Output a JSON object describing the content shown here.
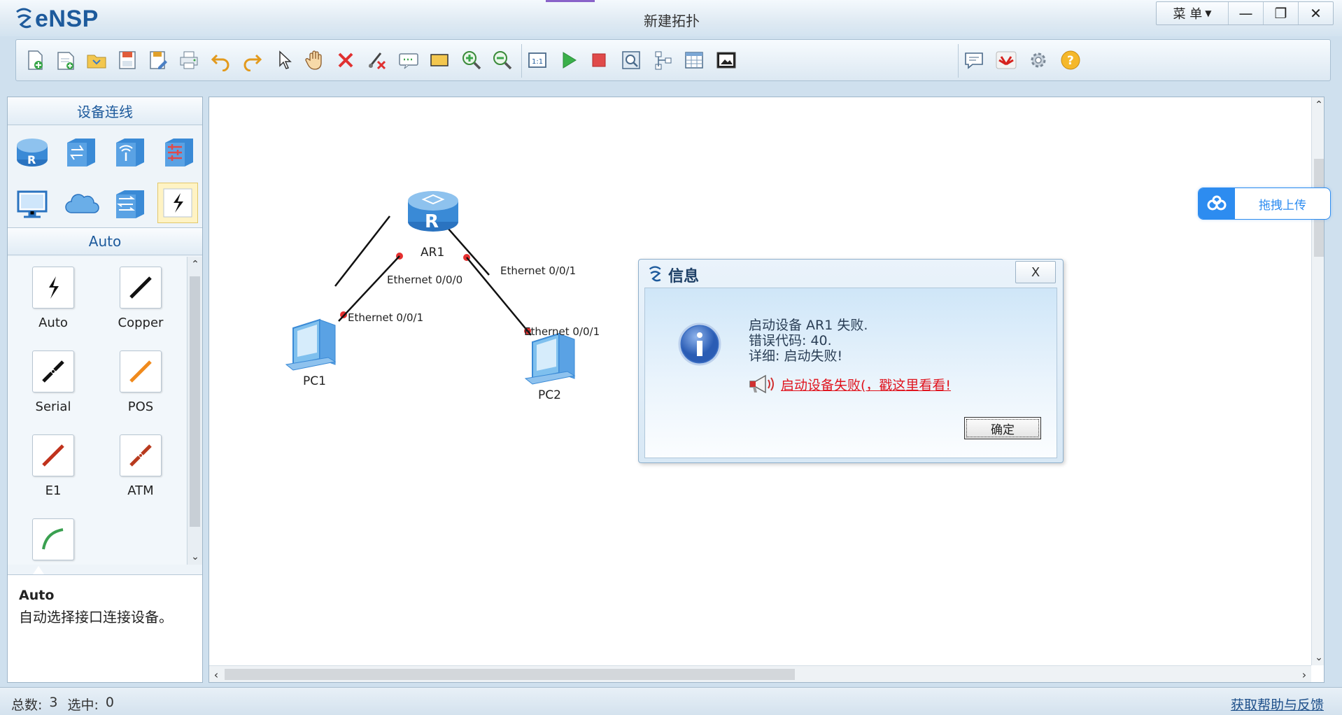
{
  "app": {
    "name": "eNSP",
    "window_title": "新建拓扑"
  },
  "window_controls": {
    "menu_label": "菜 单",
    "minimize": "—",
    "restore": "❐",
    "close": "✕"
  },
  "left_panel": {
    "section_title": "设备连线",
    "sub_title": "Auto",
    "devices": [
      {
        "icon": "router-icon"
      },
      {
        "icon": "switch-icon"
      },
      {
        "icon": "wireless-icon"
      },
      {
        "icon": "firewall-icon"
      },
      {
        "icon": "pc-icon"
      },
      {
        "icon": "cloud-icon"
      },
      {
        "icon": "other-device-icon"
      },
      {
        "icon": "cable-icon",
        "selected": true
      }
    ],
    "cables": [
      {
        "label": "Auto",
        "color": "#222222"
      },
      {
        "label": "Copper",
        "color": "#111111"
      },
      {
        "label": "Serial",
        "color": "#111111"
      },
      {
        "label": "POS",
        "color": "#f08a1c"
      },
      {
        "label": "E1",
        "color": "#c0321c"
      },
      {
        "label": "ATM",
        "color": "#b83a1e"
      },
      {
        "label": "",
        "color": "#3aa050"
      }
    ],
    "description": {
      "title": "Auto",
      "text": "自动选择接口连接设备。"
    }
  },
  "topology": {
    "nodes": [
      {
        "name": "AR1",
        "type": "router"
      },
      {
        "name": "PC1",
        "type": "pc"
      },
      {
        "name": "PC2",
        "type": "pc"
      }
    ],
    "ports": [
      {
        "label": "Ethernet 0/0/0"
      },
      {
        "label": "Ethernet 0/0/1"
      },
      {
        "label": "Ethernet 0/0/1"
      },
      {
        "label": "Ethernet 0/0/1"
      }
    ],
    "link_color": "#111111",
    "port_dot_color": "#e53030"
  },
  "upload_widget": {
    "label": "拖拽上传"
  },
  "dialog": {
    "title": "信息",
    "close_label": "X",
    "line1": "启动设备 AR1 失败.",
    "line2": "错误代码: 40.",
    "line3": "详细: 启动失败!",
    "link_text": "启动设备失败(，戳这里看看!",
    "ok_label": "确定"
  },
  "status": {
    "total_label": "总数:",
    "total_value": "3",
    "selected_label": "选中:",
    "selected_value": "0",
    "help_link": "获取帮助与反馈"
  },
  "colors": {
    "accent": "#1d5a9c",
    "link_red": "#e0141e",
    "upload_blue": "#2d8cf0"
  }
}
